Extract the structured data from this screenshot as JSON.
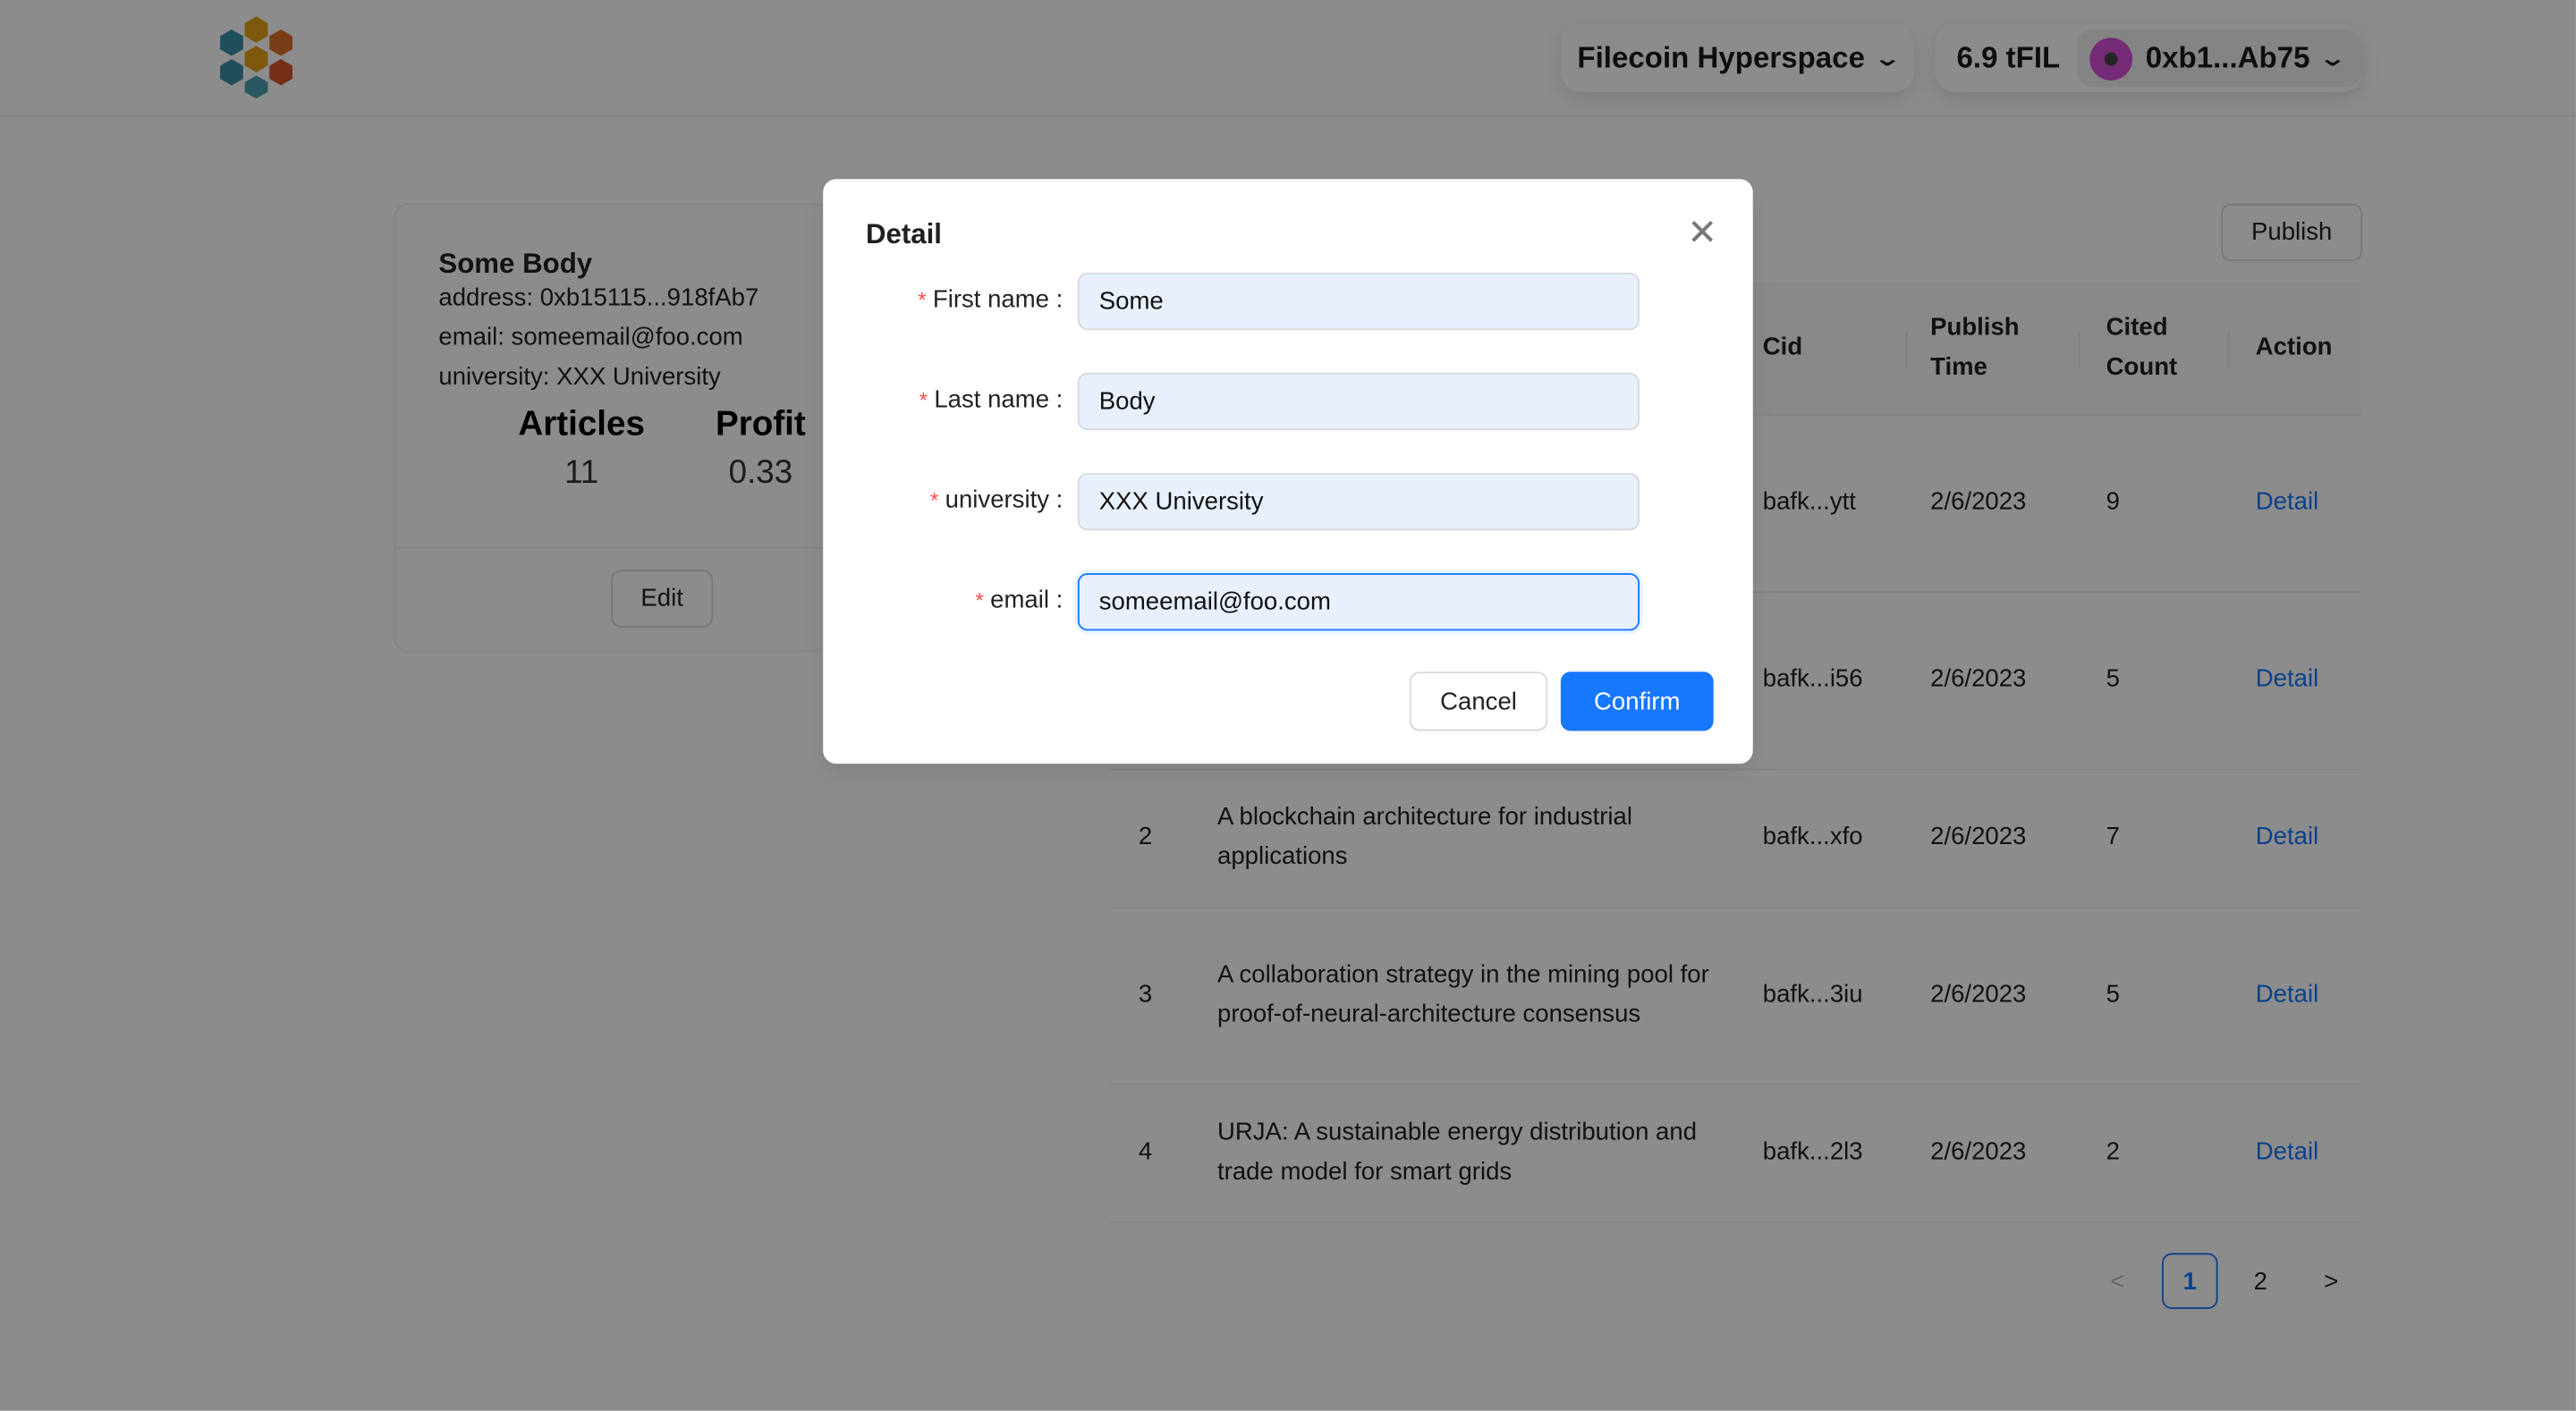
{
  "header": {
    "logo": "cube-cluster-logo",
    "network": "Filecoin Hyperspace",
    "balance": "6.9 tFIL",
    "account": "0xb1...Ab75"
  },
  "profile": {
    "name": "Some Body",
    "address": "address: 0xb15115...918fAb7",
    "email": "email: someemail@foo.com",
    "university": "university: XXX University",
    "stats": [
      {
        "label": "Articles",
        "value": "11"
      },
      {
        "label": "Profit",
        "value": "0.33"
      }
    ],
    "edit_label": "Edit"
  },
  "publish_label": "Publish",
  "table": {
    "columns": [
      "Cid",
      "Publish\nTime",
      "Cited\nCount",
      "Action"
    ],
    "column_cid": "Cid",
    "column_time_1": "Publish",
    "column_time_2": "Time",
    "column_cited_1": "Cited",
    "column_cited_2": "Count",
    "column_action": "Action",
    "rows": [
      {
        "index": "",
        "title": "",
        "cid": "bafk...ytt",
        "time": "2/6/2023",
        "cited": "9",
        "action": "Detail"
      },
      {
        "index": "",
        "title": "",
        "cid": "bafk...i56",
        "time": "2/6/2023",
        "cited": "5",
        "action": "Detail"
      },
      {
        "index": "2",
        "title": "A blockchain architecture for industrial applications",
        "cid": "bafk...xfo",
        "time": "2/6/2023",
        "cited": "7",
        "action": "Detail"
      },
      {
        "index": "3",
        "title": "A collaboration strategy in the mining pool for proof-of-neural-architecture consensus",
        "cid": "bafk...3iu",
        "time": "2/6/2023",
        "cited": "5",
        "action": "Detail"
      },
      {
        "index": "4",
        "title": "URJA: A sustainable energy distribution and trade model for smart grids",
        "cid": "bafk...2l3",
        "time": "2/6/2023",
        "cited": "2",
        "action": "Detail"
      }
    ]
  },
  "pagination": {
    "prev": "<",
    "pages": [
      "1",
      "2"
    ],
    "current": "1",
    "next": ">"
  },
  "modal": {
    "title": "Detail",
    "fields": [
      {
        "label": "First name",
        "value": "Some"
      },
      {
        "label": "Last name",
        "value": "Body"
      },
      {
        "label": "university",
        "value": "XXX University"
      },
      {
        "label": "email",
        "value": "someemail@foo.com"
      }
    ],
    "cancel_label": "Cancel",
    "confirm_label": "Confirm"
  },
  "colors": {
    "primary": "#1677ff",
    "required": "#ff4d4f",
    "input_bg": "#e8f0fe"
  }
}
